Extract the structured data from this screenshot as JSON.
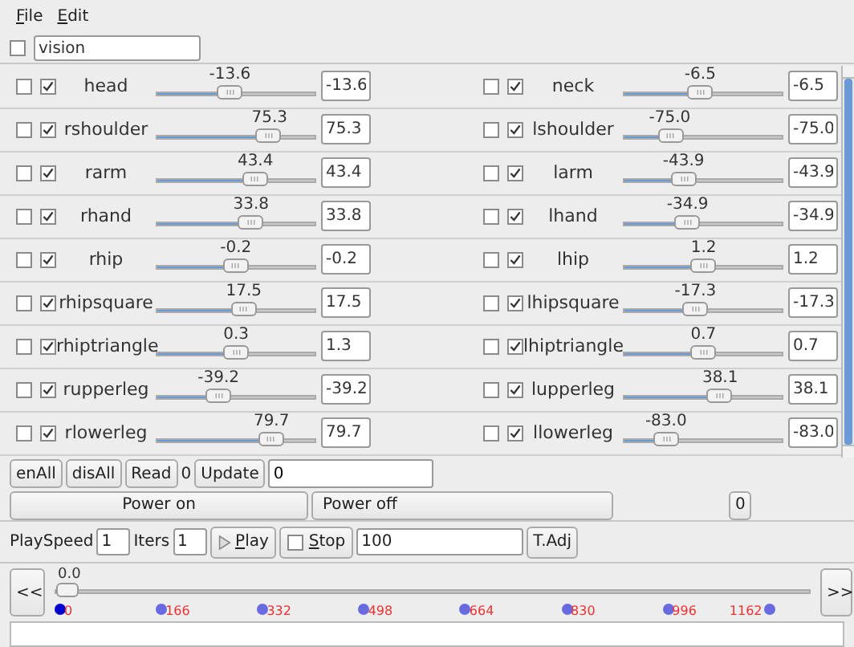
{
  "menu": [
    {
      "label": "File"
    },
    {
      "label": "Edit"
    }
  ],
  "filter": {
    "checked": false,
    "value": "vision"
  },
  "joints": [
    {
      "left": {
        "name": "head",
        "checked": false,
        "enabled": true,
        "reading": "-13.6",
        "level": 0.462,
        "value": "-13.6"
      },
      "right": {
        "name": "neck",
        "checked": false,
        "enabled": true,
        "reading": "-6.5",
        "level": 0.482,
        "value": "-6.5"
      }
    },
    {
      "left": {
        "name": "rshoulder",
        "checked": false,
        "enabled": true,
        "reading": "75.3",
        "level": 0.709,
        "value": "75.3"
      },
      "right": {
        "name": "lshoulder",
        "checked": false,
        "enabled": true,
        "reading": "-75.0",
        "level": 0.292,
        "value": "-75.0"
      }
    },
    {
      "left": {
        "name": "rarm",
        "checked": false,
        "enabled": true,
        "reading": "43.4",
        "level": 0.621,
        "value": "43.4"
      },
      "right": {
        "name": "larm",
        "checked": false,
        "enabled": true,
        "reading": "-43.9",
        "level": 0.378,
        "value": "-43.9"
      }
    },
    {
      "left": {
        "name": "rhand",
        "checked": false,
        "enabled": true,
        "reading": "33.8",
        "level": 0.594,
        "value": "33.8"
      },
      "right": {
        "name": "lhand",
        "checked": false,
        "enabled": true,
        "reading": "-34.9",
        "level": 0.403,
        "value": "-34.9"
      }
    },
    {
      "left": {
        "name": "rhip",
        "checked": false,
        "enabled": true,
        "reading": "-0.2",
        "level": 0.499,
        "value": "-0.2"
      },
      "right": {
        "name": "lhip",
        "checked": false,
        "enabled": true,
        "reading": "1.2",
        "level": 0.503,
        "value": "1.2"
      }
    },
    {
      "left": {
        "name": "rhipsquare",
        "checked": false,
        "enabled": true,
        "reading": "17.5",
        "level": 0.549,
        "value": "17.5"
      },
      "right": {
        "name": "lhipsquare",
        "checked": false,
        "enabled": true,
        "reading": "-17.3",
        "level": 0.452,
        "value": "-17.3"
      }
    },
    {
      "left": {
        "name": "rhiptriangle",
        "checked": false,
        "enabled": true,
        "reading": "0.3",
        "level": 0.501,
        "value": "1.3"
      },
      "right": {
        "name": "lhiptriangle",
        "checked": false,
        "enabled": true,
        "reading": "0.7",
        "level": 0.502,
        "value": "0.7"
      }
    },
    {
      "left": {
        "name": "rupperleg",
        "checked": false,
        "enabled": true,
        "reading": "-39.2",
        "level": 0.391,
        "value": "-39.2"
      },
      "right": {
        "name": "lupperleg",
        "checked": false,
        "enabled": true,
        "reading": "38.1",
        "level": 0.606,
        "value": "38.1"
      }
    },
    {
      "left": {
        "name": "rlowerleg",
        "checked": false,
        "enabled": true,
        "reading": "79.7",
        "level": 0.721,
        "value": "79.7"
      },
      "right": {
        "name": "llowerleg",
        "checked": false,
        "enabled": true,
        "reading": "-83.0",
        "level": 0.269,
        "value": "-83.0"
      }
    }
  ],
  "toolbar": {
    "buttons": [
      "enAll",
      "disAll",
      "Read"
    ],
    "read_count": "0",
    "update": "Update",
    "update_value": "0"
  },
  "power": {
    "on": "Power on",
    "off": "Power off",
    "count": "0"
  },
  "playbar": {
    "speed_label": "PlaySpeed",
    "speed": "1",
    "iters_label": "Iters",
    "iters": "1",
    "play": "Play",
    "stop": "Stop",
    "stop_checked": false,
    "frames": "100",
    "adjust": "T.Adj"
  },
  "timeline": {
    "prev": "<<",
    "next": ">>",
    "reading": "0.0",
    "level": 0,
    "keyframes": [
      {
        "label": "0",
        "selected": true
      },
      {
        "label": "166",
        "selected": false
      },
      {
        "label": "332",
        "selected": false
      },
      {
        "label": "498",
        "selected": false
      },
      {
        "label": "664",
        "selected": false
      },
      {
        "label": "830",
        "selected": false
      },
      {
        "label": "996",
        "selected": false
      },
      {
        "label": "1162",
        "selected": false
      }
    ]
  }
}
